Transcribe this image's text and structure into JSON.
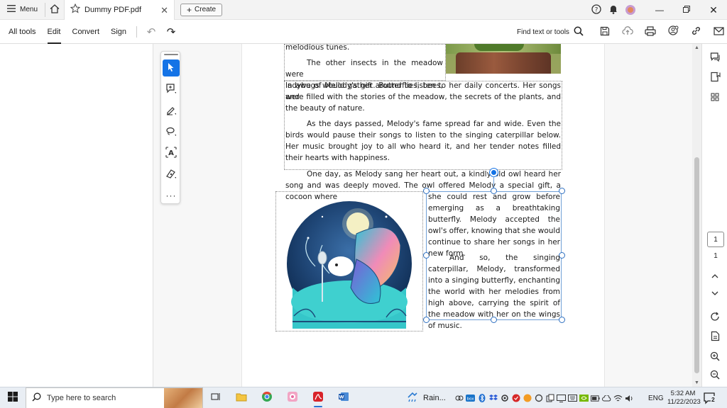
{
  "titlebar": {
    "menu_label": "Menu",
    "tab_title": "Dummy PDF.pdf",
    "create_label": "Create"
  },
  "toolbar": {
    "tabs": [
      "All tools",
      "Edit",
      "Convert",
      "Sign"
    ],
    "active_tab": "Edit",
    "find_label": "Find text or tools"
  },
  "document": {
    "line_top": "melodious tunes.",
    "para1": "The other insects in the meadow were in awe of Melody's gift. Butterflies, bees, and ladybugs would gather around to listen to her daily concerts. Her songs were filled with the stories of the meadow, the secrets of the plants, and the beauty of nature.",
    "para1_lines": [
      "The other insects in the meadow were",
      "in awe of Melody's gift. Butterflies, bees, and"
    ],
    "para1_rest": "ladybugs would gather around to listen to her daily concerts. Her songs were filled with the stories of the meadow, the secrets of the plants, and the beauty of nature.",
    "para2": "As the days passed, Melody's fame spread far and wide. Even the birds would pause their songs to listen to the singing caterpillar below. Her music brought joy to all who heard it, and her tender notes filled their hearts with happiness.",
    "para3": "One day, as Melody sang her heart out, a kindly old owl heard her song and was deeply moved. The owl offered Melody a special gift, a cocoon where",
    "para4": "she could rest and grow before emerging as a breathtaking butterfly. Melody accepted the owl's offer, knowing that she would continue to share her songs in her new form.",
    "para5": "And so, the singing caterpillar, Melody, transformed into a singing butterfly, enchanting the world with her melodies from high above, carrying the spirit of the meadow with her on the wings of music."
  },
  "navigation": {
    "current_page": "1",
    "total_pages": "1"
  },
  "taskbar": {
    "search_placeholder": "Type here to search",
    "weather": "Rain...",
    "language": "ENG",
    "time": "5:32 AM",
    "date": "11/22/2023",
    "notification_count": "2"
  },
  "colors": {
    "accent": "#1473e6",
    "selection": "#6f9fd6"
  }
}
